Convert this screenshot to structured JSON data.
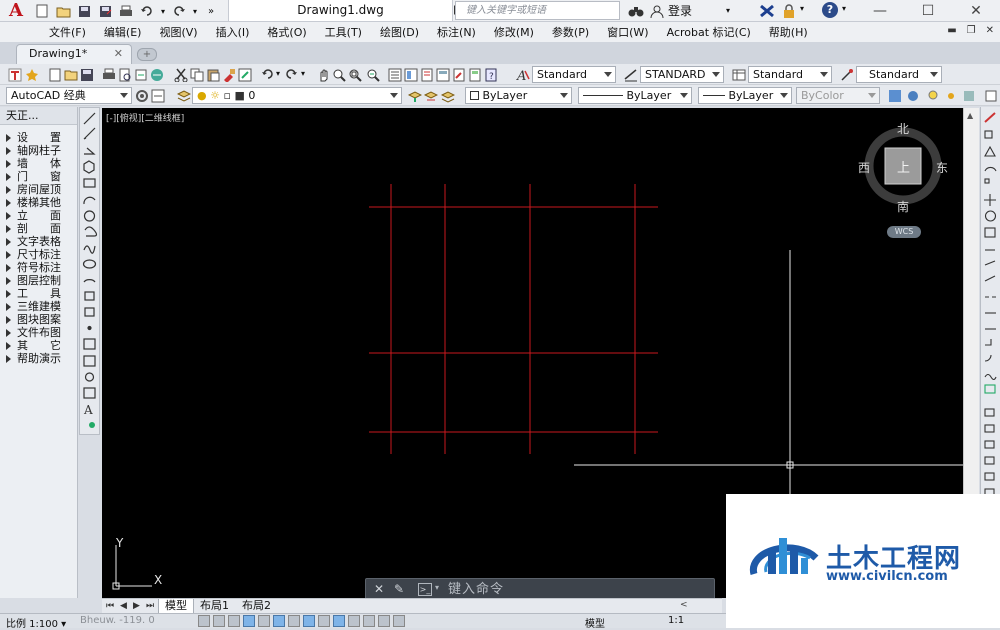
{
  "window": {
    "title": "Drawing1.dwg",
    "search_placeholder": "键入关键字或短语",
    "login_label": "登录",
    "help_label": "?"
  },
  "menu": [
    "文件(F)",
    "编辑(E)",
    "视图(V)",
    "插入(I)",
    "格式(O)",
    "工具(T)",
    "绘图(D)",
    "标注(N)",
    "修改(M)",
    "参数(P)",
    "窗口(W)",
    "Acrobat 标记(C)",
    "帮助(H)"
  ],
  "tabs": {
    "active": "Drawing1*"
  },
  "styles_toolbar": {
    "text_style": "Standard",
    "dim_style": "STANDARD",
    "table_style": "Standard",
    "mleader_style": "Standard"
  },
  "layers_toolbar": {
    "workspace": "AutoCAD 经典",
    "layer": "0",
    "color": "ByLayer",
    "linetype": "ByLayer",
    "lineweight": "ByLayer",
    "plotstyle": "ByColor"
  },
  "tz_panel": {
    "title": "天正...",
    "items": [
      "设　　置",
      "轴网柱子",
      "墙　　体",
      "门　　窗",
      "房间屋顶",
      "楼梯其他",
      "立　　面",
      "剖　　面",
      "文字表格",
      "尺寸标注",
      "符号标注",
      "图层控制",
      "工　　具",
      "三维建模",
      "图块图案",
      "文件布图",
      "其　　它",
      "帮助演示"
    ]
  },
  "viewport": {
    "label": "[-][俯视][二维线框]",
    "viewcube": {
      "north": "北",
      "south": "南",
      "east": "东",
      "west": "西",
      "face": "上",
      "wcs": "WCS"
    },
    "ucs": {
      "x_label": "X",
      "y_label": "Y"
    }
  },
  "command_line": {
    "placeholder": "键入命令"
  },
  "layout_tabs": [
    "模型",
    "布局1",
    "布局2"
  ],
  "status": {
    "scale": "比例 1:100",
    "coords": "Bheuw.  -119.  0",
    "model_label": "模型",
    "zoom": "1:1"
  },
  "watermark": {
    "title": "土木工程网",
    "url": "www.civilcn.com"
  },
  "colors": {
    "grid_line": "#c8191e",
    "canvas": "#000000",
    "accent": "#c0141c",
    "watermark": "#1e5aa8"
  }
}
